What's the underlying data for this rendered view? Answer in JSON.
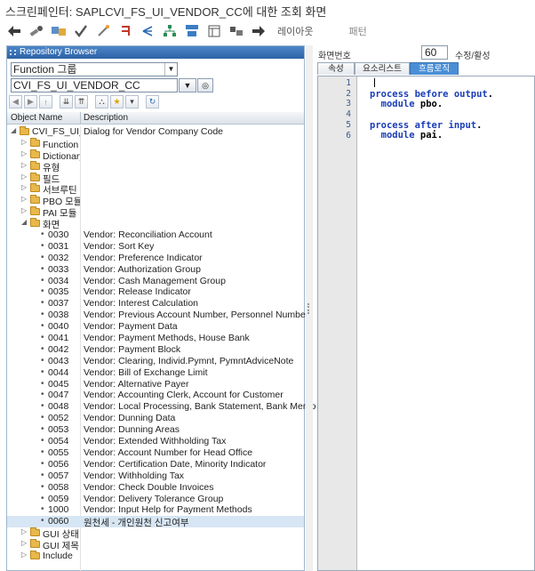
{
  "window": {
    "title": "스크린페인터: SAPLCVI_FS_UI_VENDOR_CC에 대한 조회 화면"
  },
  "toolbar": {
    "icons": [
      "back-arrow-icon",
      "toggle-display-change-icon",
      "other-object-icon",
      "check-icon",
      "activate-icon",
      "where-used-icon",
      "hierarchy-icon",
      "object-list-icon",
      "display-object-list-icon",
      "window-icon",
      "settings-icon"
    ],
    "layout_label": "레이아웃",
    "pattern_label": "패턴"
  },
  "repository": {
    "header": "Repository Browser",
    "object_type": "Function 그룹",
    "object_name": "CVI_FS_UI_VENDOR_CC",
    "col_object": "Object Name",
    "col_desc": "Description"
  },
  "tree": [
    {
      "level": 0,
      "kind": "root",
      "name": "CVI_FS_UI_VENDOR_CC",
      "desc": "Dialog for Vendor Company Code"
    },
    {
      "level": 1,
      "kind": "folder",
      "name": "Function 모듈",
      "desc": ""
    },
    {
      "level": 1,
      "kind": "folder",
      "name": "Dictionary 구조",
      "desc": ""
    },
    {
      "level": 1,
      "kind": "folder",
      "name": "유형",
      "desc": ""
    },
    {
      "level": 1,
      "kind": "folder",
      "name": "필드",
      "desc": ""
    },
    {
      "level": 1,
      "kind": "folder",
      "name": "서브루틴",
      "desc": ""
    },
    {
      "level": 1,
      "kind": "folder",
      "name": "PBO 모듈",
      "desc": ""
    },
    {
      "level": 1,
      "kind": "folder",
      "name": "PAI 모듈",
      "desc": ""
    },
    {
      "level": 1,
      "kind": "open-folder",
      "name": "화면",
      "desc": ""
    },
    {
      "level": 2,
      "kind": "item",
      "name": "0030",
      "desc": "Vendor: Reconciliation Account"
    },
    {
      "level": 2,
      "kind": "item",
      "name": "0031",
      "desc": "Vendor: Sort Key"
    },
    {
      "level": 2,
      "kind": "item",
      "name": "0032",
      "desc": "Vendor: Preference Indicator"
    },
    {
      "level": 2,
      "kind": "item",
      "name": "0033",
      "desc": "Vendor: Authorization Group"
    },
    {
      "level": 2,
      "kind": "item",
      "name": "0034",
      "desc": "Vendor: Cash Management Group"
    },
    {
      "level": 2,
      "kind": "item",
      "name": "0035",
      "desc": "Vendor: Release Indicator"
    },
    {
      "level": 2,
      "kind": "item",
      "name": "0037",
      "desc": "Vendor: Interest Calculation"
    },
    {
      "level": 2,
      "kind": "item",
      "name": "0038",
      "desc": "Vendor: Previous Account Number, Personnel Number"
    },
    {
      "level": 2,
      "kind": "item",
      "name": "0040",
      "desc": "Vendor: Payment Data"
    },
    {
      "level": 2,
      "kind": "item",
      "name": "0041",
      "desc": "Vendor: Payment Methods, House Bank"
    },
    {
      "level": 2,
      "kind": "item",
      "name": "0042",
      "desc": "Vendor: Payment Block"
    },
    {
      "level": 2,
      "kind": "item",
      "name": "0043",
      "desc": "Vendor: Clearing, Individ.Pymnt, PymntAdviceNote"
    },
    {
      "level": 2,
      "kind": "item",
      "name": "0044",
      "desc": "Vendor: Bill of Exchange Limit"
    },
    {
      "level": 2,
      "kind": "item",
      "name": "0045",
      "desc": "Vendor: Alternative Payer"
    },
    {
      "level": 2,
      "kind": "item",
      "name": "0047",
      "desc": "Vendor: Accounting Clerk, Account for Customer"
    },
    {
      "level": 2,
      "kind": "item",
      "name": "0048",
      "desc": "Vendor: Local Processing, Bank Statement, Bank Memo"
    },
    {
      "level": 2,
      "kind": "item",
      "name": "0052",
      "desc": "Vendor: Dunning Data"
    },
    {
      "level": 2,
      "kind": "item",
      "name": "0053",
      "desc": "Vendor: Dunning Areas"
    },
    {
      "level": 2,
      "kind": "item",
      "name": "0054",
      "desc": "Vendor: Extended Withholding Tax"
    },
    {
      "level": 2,
      "kind": "item",
      "name": "0055",
      "desc": "Vendor: Account Number for Head Office"
    },
    {
      "level": 2,
      "kind": "item",
      "name": "0056",
      "desc": "Vendor: Certification Date, Minority Indicator"
    },
    {
      "level": 2,
      "kind": "item",
      "name": "0057",
      "desc": "Vendor: Withholding Tax"
    },
    {
      "level": 2,
      "kind": "item",
      "name": "0058",
      "desc": "Vendor: Check Double Invoices"
    },
    {
      "level": 2,
      "kind": "item",
      "name": "0059",
      "desc": "Vendor: Delivery Tolerance Group"
    },
    {
      "level": 2,
      "kind": "item",
      "name": "1000",
      "desc": "Vendor: Input Help for Payment Methods"
    },
    {
      "level": 2,
      "kind": "item",
      "name": "0060",
      "desc": "원천세 - 개인원천 신고여부",
      "selected": true
    },
    {
      "level": 1,
      "kind": "folder",
      "name": "GUI 상태",
      "desc": ""
    },
    {
      "level": 1,
      "kind": "folder",
      "name": "GUI 제목",
      "desc": ""
    },
    {
      "level": 1,
      "kind": "folder",
      "name": "Include",
      "desc": ""
    }
  ],
  "screen": {
    "number_label": "화면번호",
    "number": "60",
    "status": "수정/활성",
    "tabs": [
      "속성",
      "요소리스트",
      "흐름로직"
    ],
    "active_tab": 2
  },
  "editor": {
    "line_numbers": [
      "1",
      "2",
      "3",
      "4",
      "5",
      "6"
    ],
    "lines": [
      [],
      [
        {
          "t": "process before output",
          "k": "kw"
        },
        {
          "t": ".",
          "k": "id"
        }
      ],
      [
        {
          "t": "  module ",
          "k": "kw"
        },
        {
          "t": "pbo",
          "k": "id"
        },
        {
          "t": ".",
          "k": "id"
        }
      ],
      [],
      [
        {
          "t": "process after input",
          "k": "kw"
        },
        {
          "t": ".",
          "k": "id"
        }
      ],
      [
        {
          "t": "  module ",
          "k": "kw"
        },
        {
          "t": "pai",
          "k": "id"
        },
        {
          "t": ".",
          "k": "id"
        }
      ]
    ]
  },
  "colors": {
    "accent": "#4a8fd6",
    "selected_row": "#d7e6f4",
    "keyword": "#1a3db8"
  }
}
